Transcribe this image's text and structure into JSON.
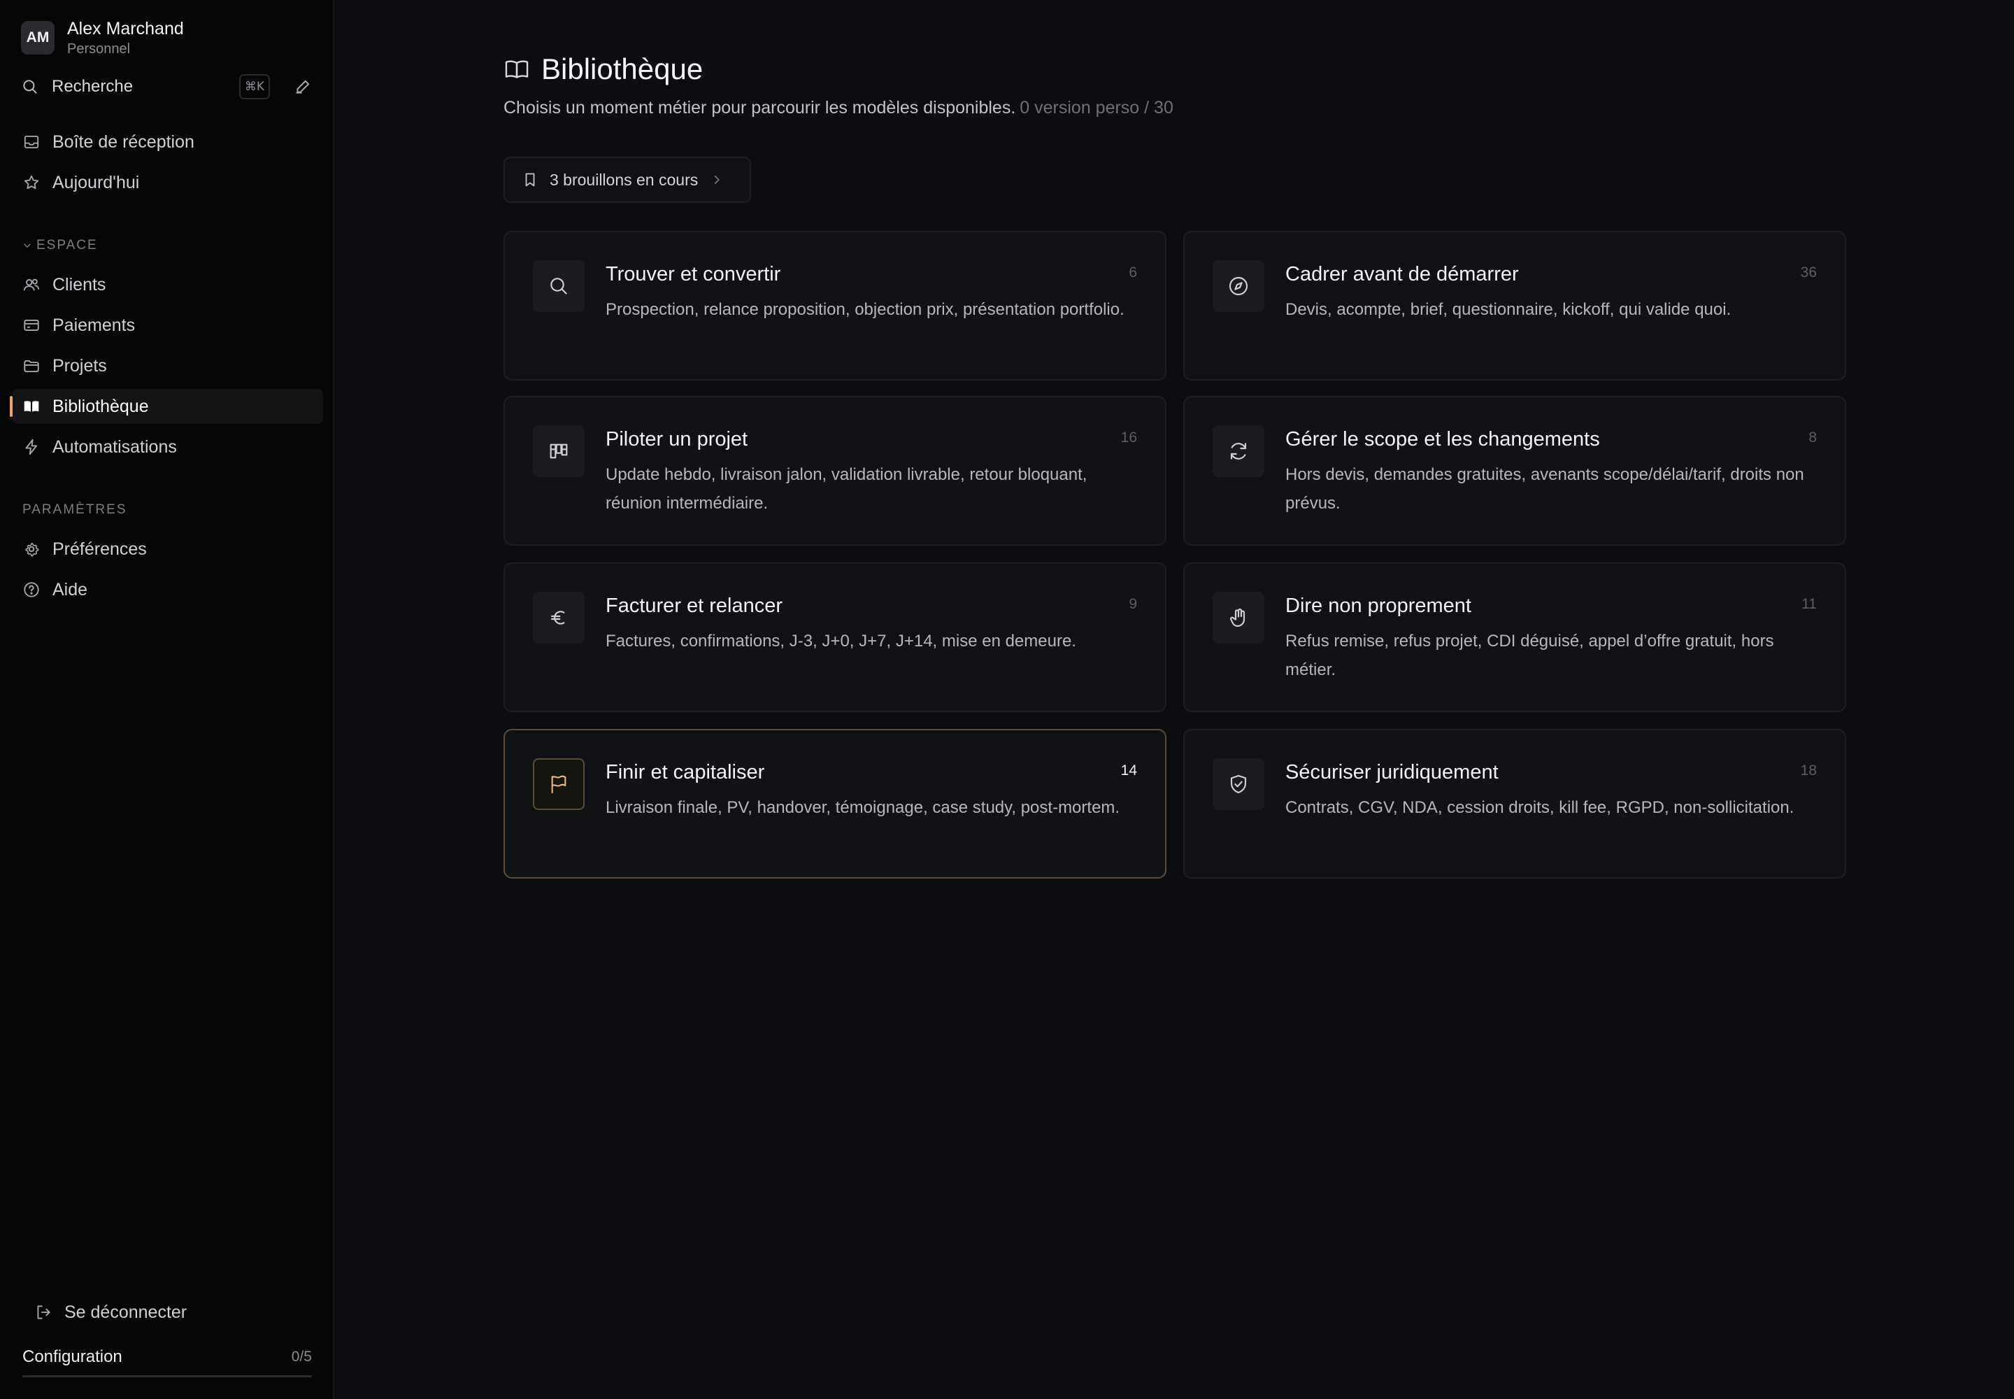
{
  "user": {
    "initials": "AM",
    "name": "Alex Marchand",
    "plan": "Personnel"
  },
  "search": {
    "label": "Recherche",
    "shortcut": "⌘K"
  },
  "nav_top": [
    {
      "label": "Boîte de réception",
      "icon": "inbox-icon"
    },
    {
      "label": "Aujourd'hui",
      "icon": "star-icon"
    }
  ],
  "space_section": {
    "label": "ESPACE",
    "items": [
      {
        "label": "Clients",
        "icon": "users-icon"
      },
      {
        "label": "Paiements",
        "icon": "credit-card-icon"
      },
      {
        "label": "Projets",
        "icon": "folder-icon"
      },
      {
        "label": "Bibliothèque",
        "icon": "book-icon",
        "active": true
      },
      {
        "label": "Automatisations",
        "icon": "bolt-icon"
      }
    ]
  },
  "settings_section": {
    "label": "PARAMÈTRES",
    "items": [
      {
        "label": "Préférences",
        "icon": "gear-icon"
      },
      {
        "label": "Aide",
        "icon": "help-icon"
      }
    ]
  },
  "logout_label": "Se déconnecter",
  "config": {
    "label": "Configuration",
    "count": "0/5",
    "progress": 0
  },
  "page": {
    "title": "Bibliothèque",
    "subtitle": "Choisis un moment métier pour parcourir les modèles disponibles.",
    "subtitle_meta": "0 version perso / 30",
    "drafts_button": "3 brouillons en cours"
  },
  "cards": [
    {
      "title": "Trouver et convertir",
      "description": "Prospection, relance proposition, objection prix, présentation portfolio.",
      "count": "6",
      "icon": "search-icon"
    },
    {
      "title": "Cadrer avant de démarrer",
      "description": "Devis, acompte, brief, questionnaire, kickoff, qui valide quoi.",
      "count": "36",
      "icon": "compass-icon"
    },
    {
      "title": "Piloter un projet",
      "description": "Update hebdo, livraison jalon, validation livrable, retour bloquant, réunion intermédiaire.",
      "count": "16",
      "icon": "kanban-icon"
    },
    {
      "title": "Gérer le scope et les changements",
      "description": "Hors devis, demandes gratuites, avenants scope/délai/tarif, droits non prévus.",
      "count": "8",
      "icon": "refresh-icon"
    },
    {
      "title": "Facturer et relancer",
      "description": "Factures, confirmations, J-3, J+0, J+7, J+14, mise en demeure.",
      "count": "9",
      "icon": "euro-icon"
    },
    {
      "title": "Dire non proprement",
      "description": "Refus remise, refus projet, CDI déguisé, appel d’offre gratuit, hors métier.",
      "count": "11",
      "icon": "hand-icon"
    },
    {
      "title": "Finir et capitaliser",
      "description": "Livraison finale, PV, handover, témoignage, case study, post-mortem.",
      "count": "14",
      "icon": "flag-icon",
      "highlighted": true
    },
    {
      "title": "Sécuriser juridiquement",
      "description": "Contrats, CGV, NDA, cession droits, kill fee, RGPD, non-sollicitation.",
      "count": "18",
      "icon": "shield-check-icon"
    }
  ],
  "colors": {
    "accent": "#e9a86a",
    "background": "#0c0d10",
    "sidebar": "#060606",
    "card": "#111215",
    "highlight_border": "#5e4d34"
  }
}
